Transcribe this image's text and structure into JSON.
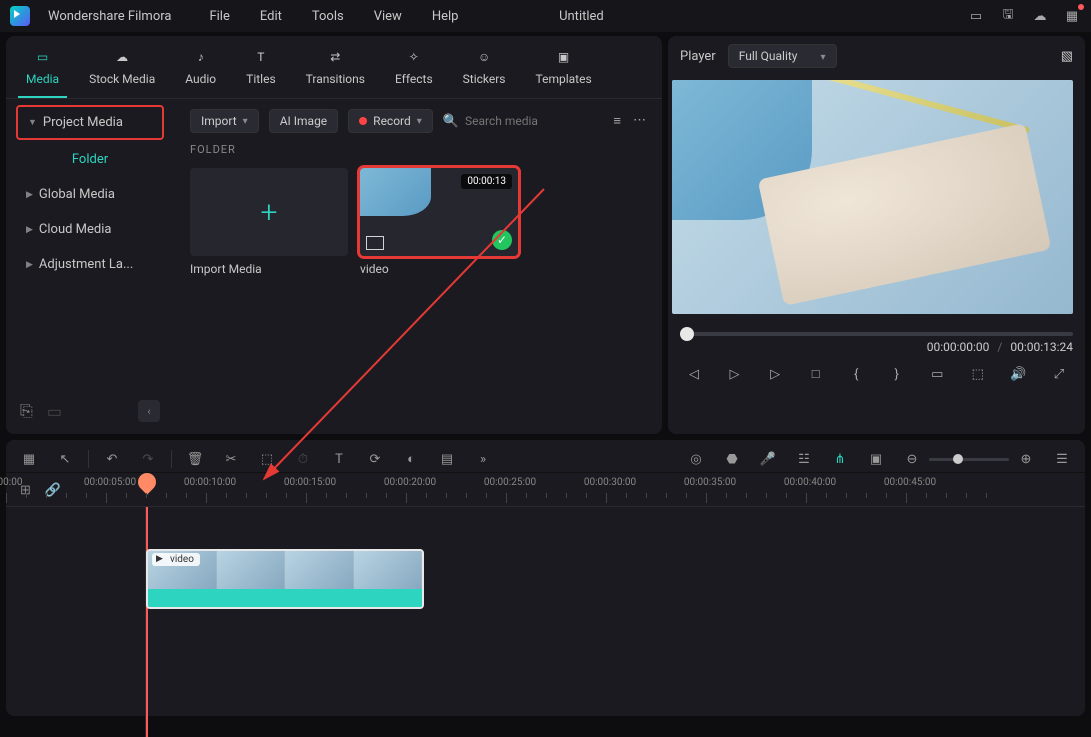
{
  "app": {
    "name": "Wondershare Filmora",
    "doc": "Untitled"
  },
  "menu": {
    "file": "File",
    "edit": "Edit",
    "tools": "Tools",
    "view": "View",
    "help": "Help"
  },
  "tabs": {
    "media": "Media",
    "stock": "Stock Media",
    "audio": "Audio",
    "titles": "Titles",
    "transitions": "Transitions",
    "effects": "Effects",
    "stickers": "Stickers",
    "templates": "Templates"
  },
  "toolbar": {
    "import": "Import",
    "ai": "AI Image",
    "record": "Record",
    "search_ph": "Search media"
  },
  "sidebar": {
    "project": "Project Media",
    "folder": "Folder",
    "global": "Global Media",
    "cloud": "Cloud Media",
    "adjust": "Adjustment La..."
  },
  "grid": {
    "heading": "FOLDER",
    "import_label": "Import Media",
    "video_label": "video",
    "video_dur": "00:00:13"
  },
  "player": {
    "label": "Player",
    "quality": "Full Quality",
    "cur": "00:00:00:00",
    "total": "00:00:13:24"
  },
  "ruler": [
    "00:00",
    "00:00:05:00",
    "00:00:10:00",
    "00:00:15:00",
    "00:00:20:00",
    "00:00:25:00",
    "00:00:30:00",
    "00:00:35:00",
    "00:00:40:00",
    "00:00:45:00"
  ],
  "tracks": {
    "video": "1",
    "audio": "1"
  },
  "clip": {
    "name": "video"
  }
}
